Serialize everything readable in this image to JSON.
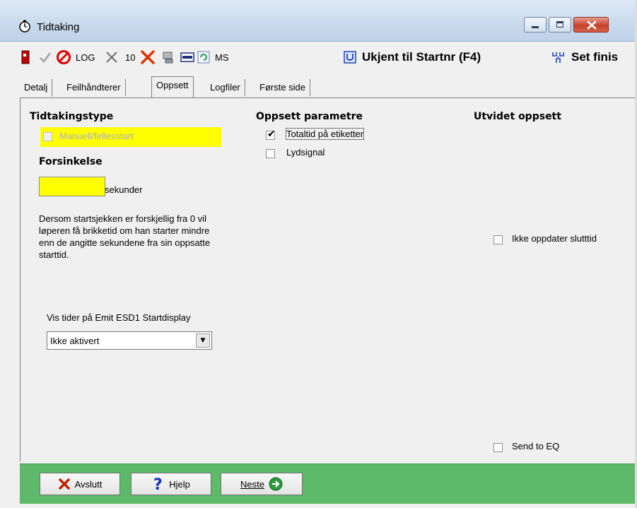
{
  "window": {
    "title": "Tidtaking",
    "icon": "stopwatch-icon"
  },
  "toolbar": {
    "log_label": "LOG",
    "ten_label": "10",
    "ms_label": "MS",
    "unknown_label": "Ukjent til Startnr (F4)",
    "set_finish_label": "Set finis"
  },
  "tabs": [
    {
      "label": "Detalj"
    },
    {
      "label": "Feilhåndterer"
    },
    {
      "label": "Oppsett"
    },
    {
      "label": "Logfiler"
    },
    {
      "label": "Første side"
    }
  ],
  "left": {
    "heading": "Tidtakingstype",
    "manual_label": "Manuell/fellesstart",
    "delay_heading": "Forsinkelse",
    "delay_value": "",
    "seconds_label": "sekunder",
    "info_text": "Dersom startsjekken er forskjellig fra 0 vil løperen få brikketid om han starter mindre enn de angitte sekundene fra sin oppsatte starttid.",
    "display_label": "Vis tider på Emit ESD1 Startdisplay",
    "display_value": "Ikke aktivert"
  },
  "middle": {
    "heading": "Oppsett parametre",
    "total_time_label": "Totaltid på etiketter",
    "total_time_checked": true,
    "sound_label": "Lydsignal",
    "sound_checked": false
  },
  "right": {
    "heading": "Utvidet oppsett",
    "no_update_label": "Ikke oppdater slutttid",
    "send_eq_label": "Send to EQ"
  },
  "buttons": {
    "quit_label": "Avslutt",
    "help_label": "Hjelp",
    "next_label": "Neste"
  },
  "colors": {
    "highlight_yellow": "#ffff00",
    "bottom_bar_green": "#5cba6a"
  }
}
